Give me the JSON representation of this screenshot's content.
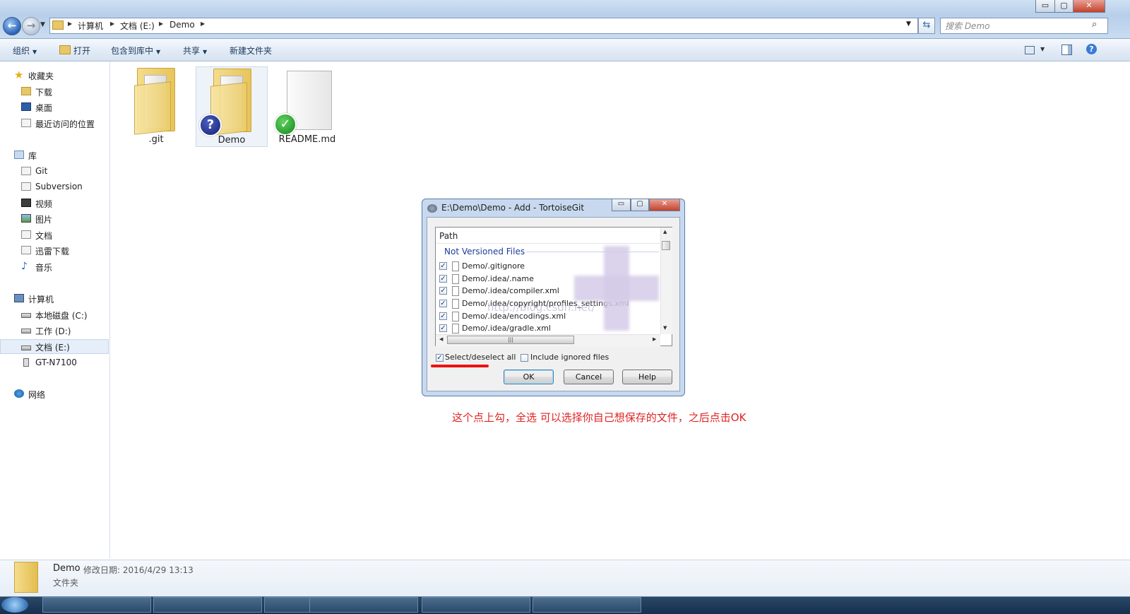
{
  "window": {
    "breadcrumbs": [
      "计算机",
      "文档 (E:)",
      "Demo"
    ],
    "search_placeholder": "搜索 Demo",
    "controls": {
      "minimize": "▭",
      "maximize": "▢",
      "close": "✕"
    }
  },
  "toolbar": {
    "organize": "组织",
    "open": "打开",
    "include_in_library": "包含到库中",
    "share": "共享",
    "new_folder": "新建文件夹"
  },
  "nav": {
    "favorites": {
      "label": "收藏夹",
      "items": [
        "下载",
        "桌面",
        "最近访问的位置"
      ]
    },
    "libraries": {
      "label": "库",
      "items": [
        "Git",
        "Subversion",
        "视频",
        "图片",
        "文档",
        "迅雷下载",
        "音乐"
      ]
    },
    "computer": {
      "label": "计算机",
      "items": [
        "本地磁盘 (C:)",
        "工作 (D:)",
        "文档 (E:)",
        "GT-N7100"
      ],
      "selected": "文档 (E:)"
    },
    "network": {
      "label": "网络"
    }
  },
  "files": [
    {
      "name": ".git",
      "type": "folder",
      "overlay": "none"
    },
    {
      "name": "Demo",
      "type": "folder",
      "overlay": "unversioned",
      "selected": true
    },
    {
      "name": "README.md",
      "type": "file",
      "overlay": "normal"
    }
  ],
  "dialog": {
    "title": "E:\\Demo\\Demo - Add - TortoiseGit",
    "column_path": "Path",
    "group_label": "Not Versioned Files",
    "rows": [
      {
        "path": "Demo/.gitignore",
        "checked": true
      },
      {
        "path": "Demo/.idea/.name",
        "checked": true
      },
      {
        "path": "Demo/.idea/compiler.xml",
        "checked": true
      },
      {
        "path": "Demo/.idea/copyright/profiles_settings.xml",
        "checked": true
      },
      {
        "path": "Demo/.idea/encodings.xml",
        "checked": true
      },
      {
        "path": "Demo/.idea/gradle.xml",
        "checked": true
      }
    ],
    "watermark": "http://blog.csdn.net/",
    "select_all_label": "Select/deselect all",
    "select_all_checked": true,
    "include_ignored_label": "Include ignored files",
    "include_ignored_checked": false,
    "buttons": {
      "ok": "OK",
      "cancel": "Cancel",
      "help": "Help"
    },
    "controls": {
      "minimize": "▭",
      "maximize": "▢",
      "close": "✕"
    }
  },
  "annotation": "这个点上勾，全选 可以选择你自己想保存的文件，之后点击OK",
  "details": {
    "name": "Demo",
    "modified": "修改日期: 2016/4/29 13:13",
    "type": "文件夹"
  }
}
